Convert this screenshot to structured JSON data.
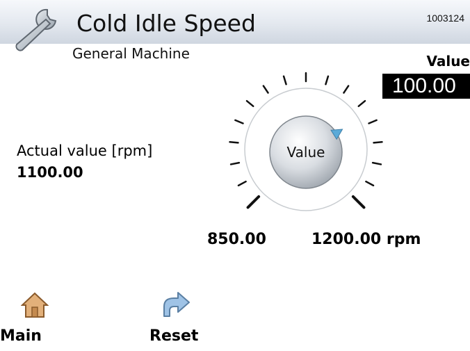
{
  "header": {
    "title": "Cold Idle Speed",
    "code": "1003124",
    "icon": "wrench-icon"
  },
  "subtitle": "General Machine",
  "setpoint": {
    "label": "Value",
    "value": "100.00"
  },
  "actual": {
    "label": "Actual value [rpm]",
    "value": "1100.00"
  },
  "dial": {
    "knob_label": "Value",
    "min_label": "850.00",
    "max_label": "1200.00 rpm",
    "min": 850,
    "max": 1200,
    "indicator_value": 1100
  },
  "nav": {
    "main_label": "Main",
    "main_icon": "home-icon",
    "reset_label": "Reset",
    "reset_icon": "undo-arrow-icon"
  },
  "colors": {
    "value_box_bg": "#000000",
    "indicator": "#5aaad8"
  }
}
